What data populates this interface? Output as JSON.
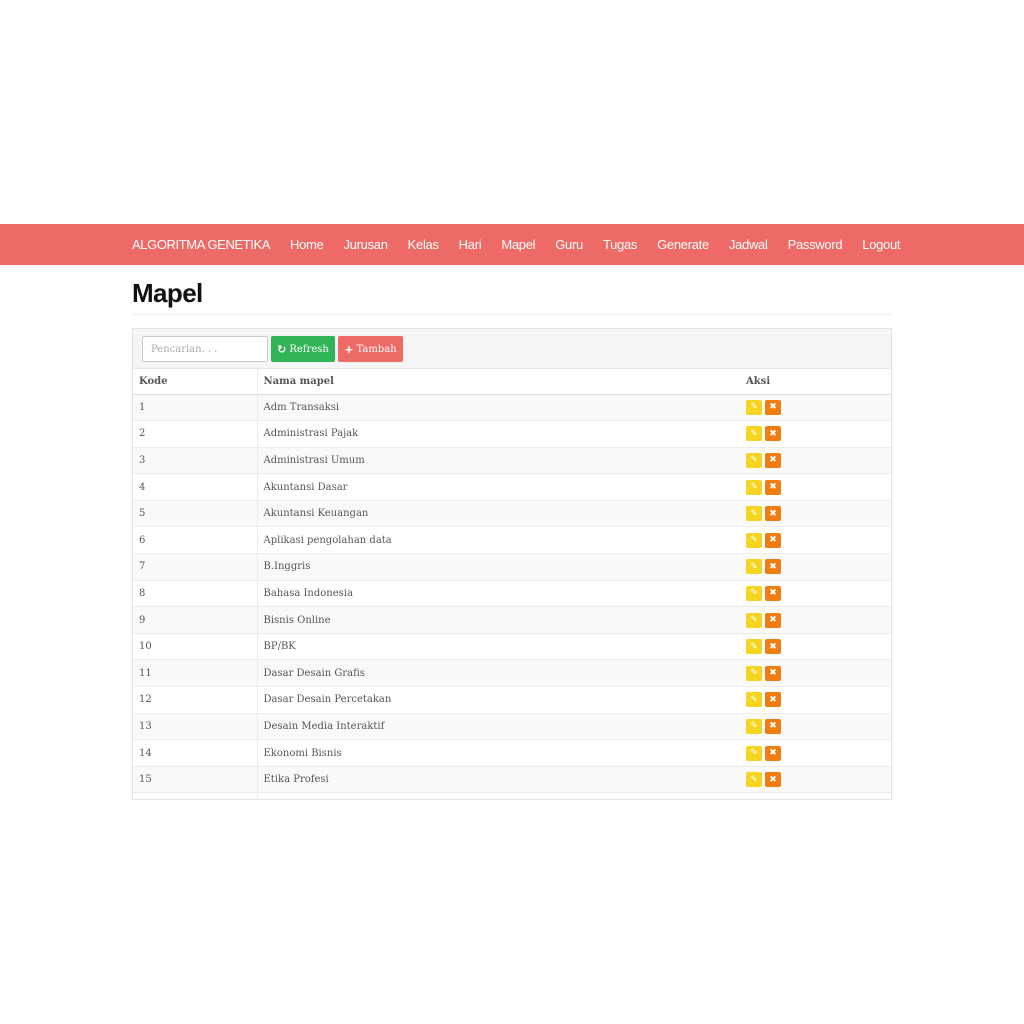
{
  "navbar": {
    "brand": "ALGORITMA GENETIKA",
    "items": [
      "Home",
      "Jurusan",
      "Kelas",
      "Hari",
      "Mapel",
      "Guru",
      "Tugas",
      "Generate",
      "Jadwal",
      "Password",
      "Logout"
    ]
  },
  "page": {
    "title": "Mapel"
  },
  "toolbar": {
    "search_placeholder": "Pencarian. . .",
    "refresh_label": "Refresh",
    "add_label": "Tambah"
  },
  "table": {
    "headers": [
      "Kode",
      "Nama mapel",
      "Aksi"
    ],
    "rows": [
      {
        "kode": "1",
        "nama": "Adm Transaksi"
      },
      {
        "kode": "2",
        "nama": "Administrasi Pajak"
      },
      {
        "kode": "3",
        "nama": "Administrasi Umum"
      },
      {
        "kode": "4",
        "nama": "Akuntansi Dasar"
      },
      {
        "kode": "5",
        "nama": "Akuntansi Keuangan"
      },
      {
        "kode": "6",
        "nama": "Aplikasi pengolahan data"
      },
      {
        "kode": "7",
        "nama": "B.Inggris"
      },
      {
        "kode": "8",
        "nama": "Bahasa Indonesia"
      },
      {
        "kode": "9",
        "nama": "Bisnis Online"
      },
      {
        "kode": "10",
        "nama": "BP/BK"
      },
      {
        "kode": "11",
        "nama": "Dasar Desain Grafis"
      },
      {
        "kode": "12",
        "nama": "Dasar Desain Percetakan"
      },
      {
        "kode": "13",
        "nama": "Desain Media Interaktif"
      },
      {
        "kode": "14",
        "nama": "Ekonomi Bisnis"
      },
      {
        "kode": "15",
        "nama": "Etika Profesi"
      },
      {
        "kode": "",
        "nama": ""
      }
    ]
  },
  "colors": {
    "navbar": "#ed6a66",
    "refresh": "#2fb457",
    "add": "#ed6a66",
    "edit": "#f5d422",
    "delete": "#f07d12"
  }
}
